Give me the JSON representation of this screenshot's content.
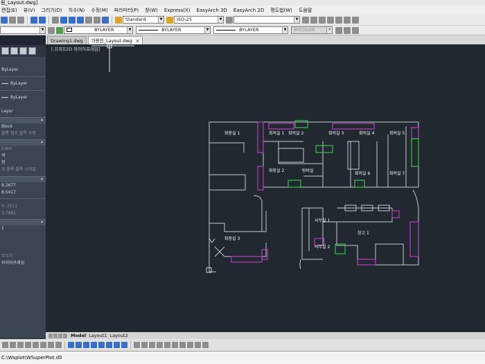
{
  "window": {
    "title": "됨_Layout.dwg]"
  },
  "menu": [
    "편집(E)",
    "뷰(V)",
    "그리기(D)",
    "치수(N)",
    "수정(M)",
    "파라미터(P)",
    "창(W)",
    "Express(X)",
    "EasyArch 3D",
    "EasyArch 2D",
    "평도법(W)",
    "도움말"
  ],
  "toolbar": {
    "text_style": "Standard",
    "dim_style": "ISO-25",
    "color": "BYLAYER",
    "linetype": "BYLAYER",
    "lineweight": "BYLAYER",
    "plotstyle": "BYCOLOR"
  },
  "file_tabs": [
    {
      "label": "Drawing1.dwg",
      "active": false
    },
    {
      "label": "가용인_Layout.dwg",
      "active": true
    }
  ],
  "palette": {
    "rows": [
      "ByLayer",
      "ByLayer",
      "ByLayer",
      "Layer",
      "Block",
      "블록 참조 블록 수정",
      "Color",
      "색",
      "형",
      "상 블록 블록 스타일",
      "8.2677",
      "8.5417",
      "0: 2511",
      "3.7881",
      "1",
      "무수기",
      "와이어프레임"
    ]
  },
  "viewport_label": "[-][위][2D 와이어프레임]",
  "room_labels": [
    "화장실 1",
    "회의실 1",
    "회의실 2",
    "회의실 3",
    "회의실 4",
    "회의실 5",
    "화장실 2",
    "탕비실",
    "회의실 6",
    "회의실 7",
    "사무실 1",
    "사무실 2",
    "화장실 3",
    "창고 1"
  ],
  "layout_tabs": [
    {
      "label": "Model",
      "active": true
    },
    {
      "label": "Layout1",
      "active": false
    },
    {
      "label": "Layout2",
      "active": false
    }
  ],
  "command_line": "C:\\Wsplot\\WSuperPlot.dll",
  "colors": {
    "wall": "#c8ccd2",
    "furniture_magenta": "#b53fb6",
    "furniture_green": "#3fbf52",
    "canvas": "#212830"
  }
}
